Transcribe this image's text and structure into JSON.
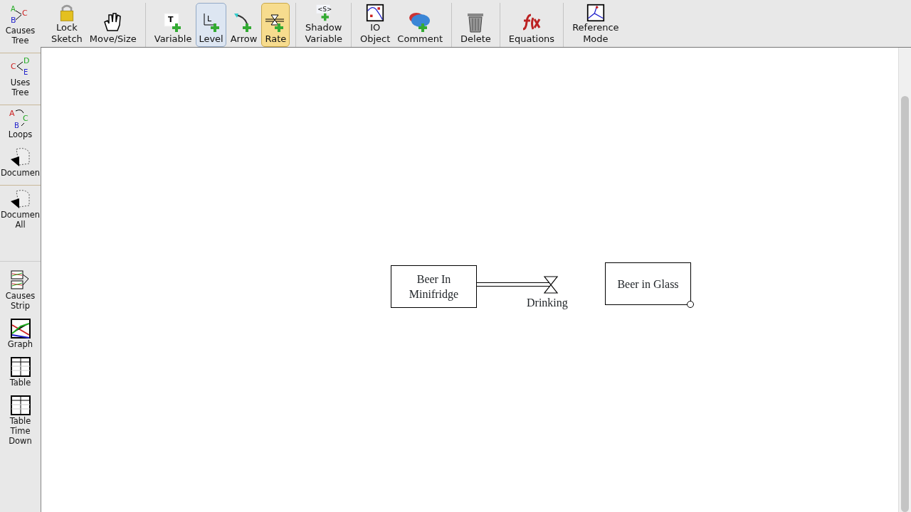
{
  "sidebar": {
    "groups": [
      [
        {
          "label": "Causes\nTree",
          "kind": "causes-tree",
          "icon_text": [
            "A",
            "C",
            "B"
          ]
        }
      ],
      [
        {
          "label": "Uses\nTree",
          "kind": "uses-tree",
          "icon_text": [
            "C",
            "D",
            "E"
          ]
        }
      ],
      [
        {
          "label": "Loops",
          "kind": "loops",
          "icon_text": [
            "A",
            "C",
            "B"
          ]
        },
        {
          "label": "Documen",
          "kind": "document"
        }
      ],
      [
        {
          "label": "Documen\nAll",
          "kind": "document"
        }
      ],
      [
        {
          "label": "Causes\nStrip",
          "kind": "strip"
        },
        {
          "label": "Graph",
          "kind": "graph"
        },
        {
          "label": "Table",
          "kind": "table"
        },
        {
          "label": "Table\nTime\nDown",
          "kind": "table"
        }
      ]
    ]
  },
  "toolbar": {
    "groups": [
      [
        {
          "label": "Lock\nSketch",
          "kind": "lock",
          "selected": false,
          "focused": false
        },
        {
          "label": "Move/Size",
          "kind": "hand",
          "selected": false,
          "focused": false
        }
      ],
      [
        {
          "label": "Variable",
          "kind": "variable",
          "icon_text": [
            "T"
          ],
          "selected": false,
          "focused": false
        },
        {
          "label": "Level",
          "kind": "level",
          "icon_text": [
            "L"
          ],
          "selected": false,
          "focused": true
        },
        {
          "label": "Arrow",
          "kind": "arrow",
          "selected": false,
          "focused": false
        },
        {
          "label": "Rate",
          "kind": "rate",
          "selected": true,
          "focused": false
        }
      ],
      [
        {
          "label": "Shadow\nVariable",
          "kind": "shadow",
          "icon_text": [
            "<S>"
          ],
          "selected": false,
          "focused": false
        }
      ],
      [
        {
          "label": "IO\nObject",
          "kind": "io",
          "selected": false,
          "focused": false
        },
        {
          "label": "Comment",
          "kind": "comment",
          "selected": false,
          "focused": false
        }
      ],
      [
        {
          "label": "Delete",
          "kind": "trash",
          "selected": false,
          "focused": false
        }
      ],
      [
        {
          "label": "Equations",
          "kind": "fx",
          "selected": false,
          "focused": false
        }
      ],
      [
        {
          "label": "Reference\nMode",
          "kind": "refmode",
          "selected": false,
          "focused": false
        }
      ]
    ]
  },
  "diagram": {
    "nodes": [
      {
        "kind": "stock",
        "label": "Beer In\nMinifridge",
        "selected": false
      },
      {
        "kind": "rate",
        "label": "Drinking",
        "selected": false
      },
      {
        "kind": "stock",
        "label": "Beer in Glass",
        "selected": true
      }
    ]
  }
}
